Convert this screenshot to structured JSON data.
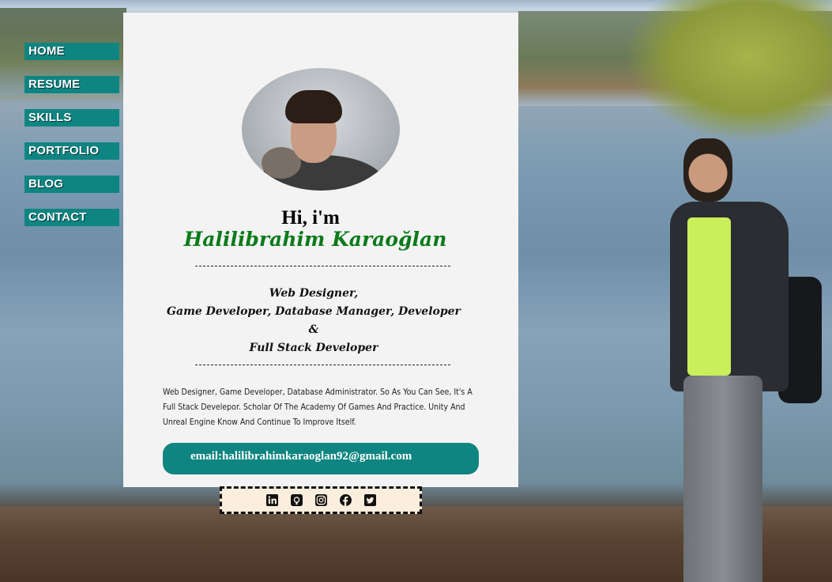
{
  "nav": {
    "items": [
      {
        "label": "HOME"
      },
      {
        "label": "RESUME"
      },
      {
        "label": "SKILLS"
      },
      {
        "label": "PORTFOLIO"
      },
      {
        "label": "BLOG"
      },
      {
        "label": "CONTACT"
      }
    ]
  },
  "profile": {
    "greeting": "Hi, i'm",
    "name": "Halilibrahim Karaoğlan",
    "roles": {
      "line1": "Web Designer,",
      "line2": "Game Developer, Database Manager, Developer",
      "line3": "&",
      "line4": "Full Stack Developer"
    },
    "bio": "Web Designer, Game Developer, Database Administrator. So As You Can See, It's A Full Stack Develepor. Scholar Of The Academy Of Games And Practice. Unity And Unreal Engine Know And Continue To Improve Itself.",
    "email": "email:halilibrahimkaraoglan92@gmail.com"
  },
  "social": {
    "icons": [
      "linkedin-icon",
      "github-icon",
      "instagram-icon",
      "facebook-icon",
      "twitter-icon"
    ]
  },
  "colors": {
    "accent": "#0f8581",
    "name_green": "#0a7a1a",
    "card_bg": "#f3f3f3",
    "social_bg": "#fbeedd"
  }
}
